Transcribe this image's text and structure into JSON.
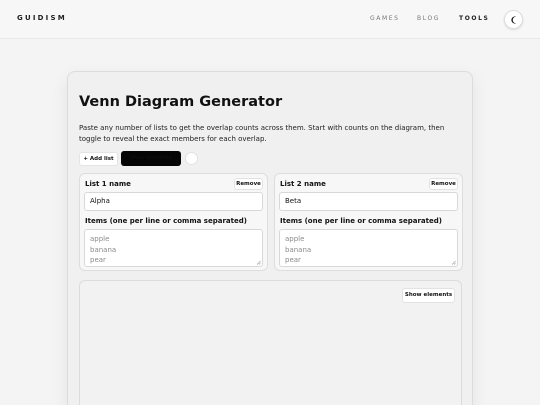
{
  "header": {
    "logo": "GUIDISM",
    "nav": [
      {
        "label": "GAMES",
        "active": false
      },
      {
        "label": "BLOG",
        "active": false
      },
      {
        "label": "TOOLS",
        "active": true
      }
    ],
    "theme_icon": "moon-icon"
  },
  "tool": {
    "title": "Venn Diagram Generator",
    "description": "Paste any number of lists to get the overlap counts across them. Start with counts on the diagram, then toggle to reveal the exact members for each overlap.",
    "add_list_label": "+ Add list",
    "toggle_label": "Show elements",
    "lists": [
      {
        "name_label": "List 1 name",
        "name_value": "Alpha",
        "remove_label": "Remove",
        "items_label": "Items (one per line or comma separated)",
        "items_placeholder": [
          "apple",
          "banana",
          "pear"
        ]
      },
      {
        "name_label": "List 2 name",
        "name_value": "Beta",
        "remove_label": "Remove",
        "items_label": "Items (one per line or comma separated)",
        "items_placeholder": [
          "apple",
          "banana",
          "pear"
        ]
      }
    ],
    "diagram": {
      "show_elements_label": "Show elements"
    }
  },
  "colors": {
    "page_bg": "#f4f4f4",
    "card_bg": "#f0f0f0",
    "toggle_bg": "#050505"
  }
}
